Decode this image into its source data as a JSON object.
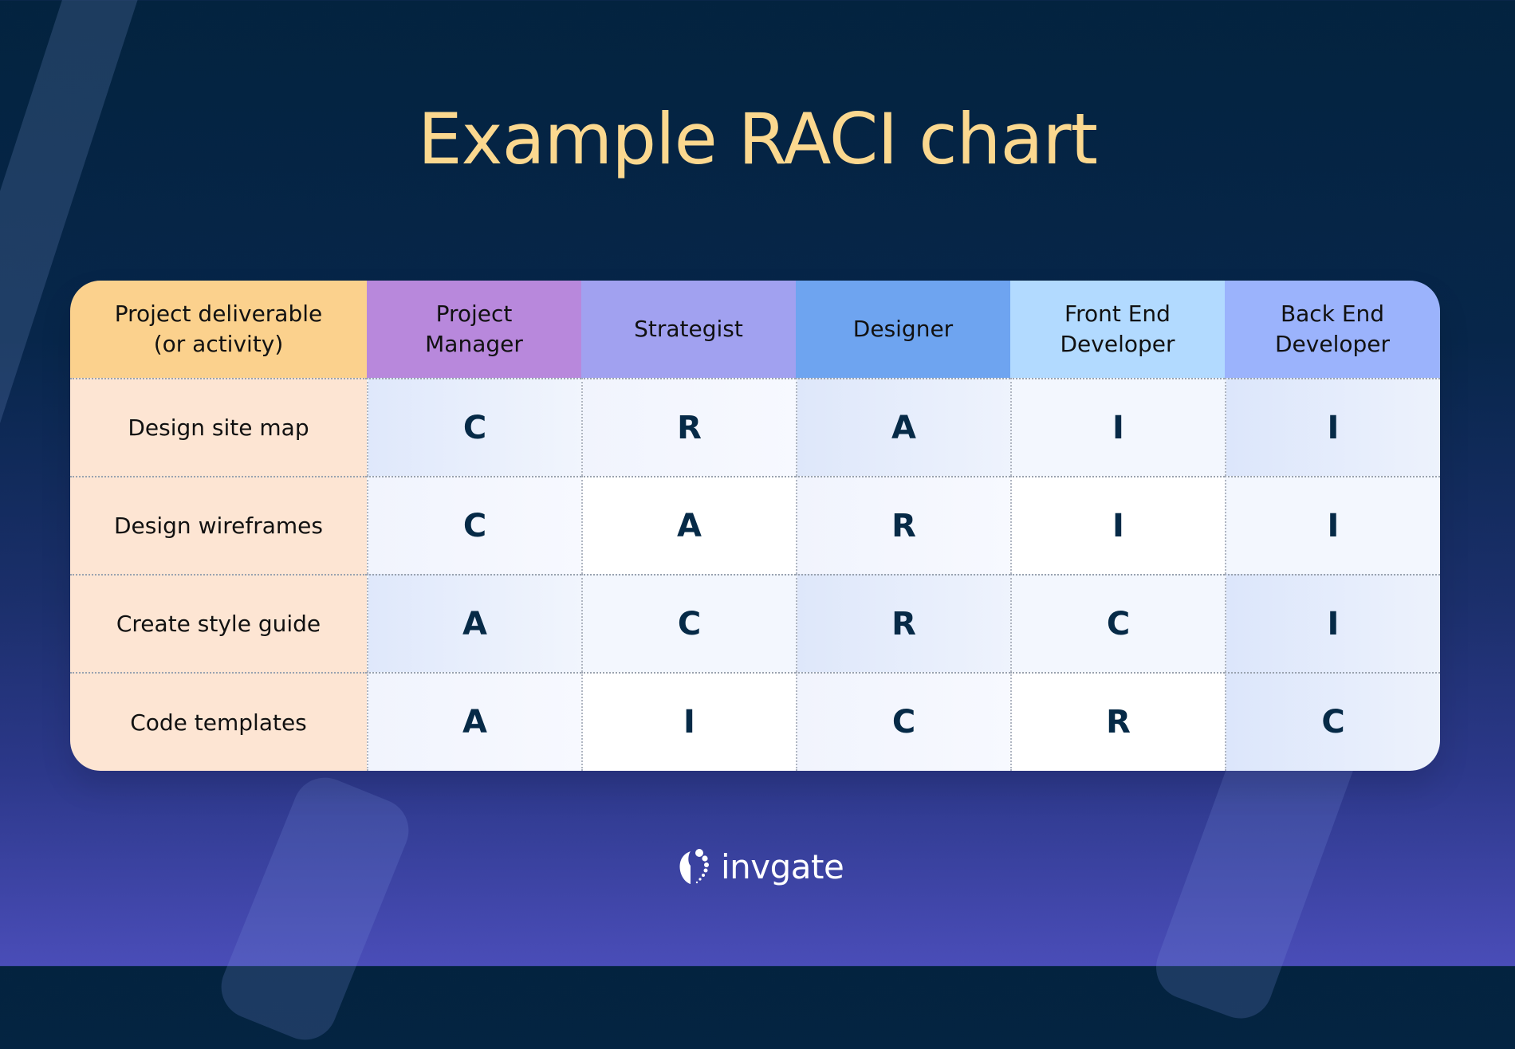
{
  "title": "Example RACI chart",
  "table": {
    "headers": [
      {
        "line1": "Project deliverable",
        "line2": "(or activity)"
      },
      {
        "line1": "Project",
        "line2": "Manager"
      },
      {
        "line1": "Strategist",
        "line2": ""
      },
      {
        "line1": "Designer",
        "line2": ""
      },
      {
        "line1": "Front End",
        "line2": "Developer"
      },
      {
        "line1": "Back End",
        "line2": "Developer"
      }
    ],
    "header_colors": [
      "#fbd18d",
      "#b888dc",
      "#a1a1f0",
      "#6ea4f0",
      "#b2daff",
      "#9bb3fc"
    ],
    "rows": [
      {
        "activity": "Design site map",
        "values": [
          "C",
          "R",
          "A",
          "I",
          "I"
        ]
      },
      {
        "activity": "Design wireframes",
        "values": [
          "C",
          "A",
          "R",
          "I",
          "I"
        ]
      },
      {
        "activity": "Create style guide",
        "values": [
          "A",
          "C",
          "R",
          "C",
          "I"
        ]
      },
      {
        "activity": "Code templates",
        "values": [
          "A",
          "I",
          "C",
          "R",
          "C"
        ]
      }
    ]
  },
  "logo": {
    "text": "invgate",
    "icon": "invgate-logo-icon"
  },
  "colors": {
    "title": "#fbd88f",
    "background_top": "#03233f",
    "background_bottom": "#4a4db8",
    "letter": "#062a47"
  }
}
